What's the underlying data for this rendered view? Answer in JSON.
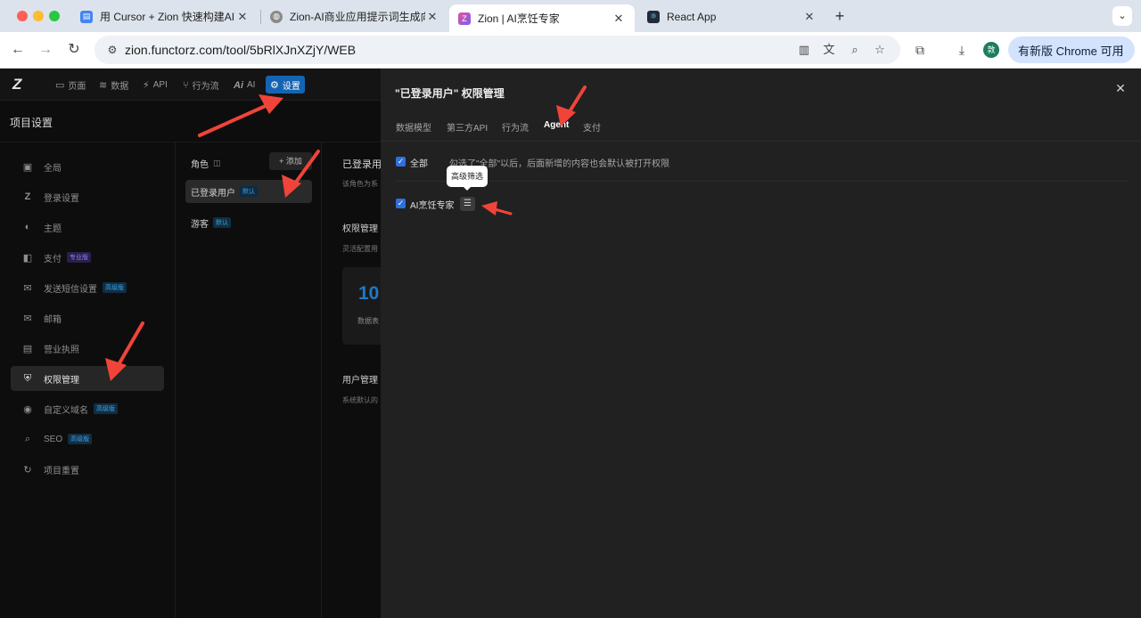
{
  "browser": {
    "tabs": [
      {
        "title": "用 Cursor + Zion 快速构建AI商",
        "favicon_color": "#4285f4"
      },
      {
        "title": "Zion-AI商业应用提示词生成向导",
        "favicon_color": "#8a8a8a"
      },
      {
        "title": "Zion | AI烹饪专家",
        "favicon_color": "#a35bf5"
      },
      {
        "title": "React App",
        "favicon_color": "#1f2a3a"
      }
    ],
    "url": "zion.functorz.com/tool/5bRlXJnXZjY/WEB",
    "update_label": "有新版 Chrome 可用",
    "profile_initial": "敦"
  },
  "app": {
    "nav": [
      {
        "label": "页面",
        "icon": "▭"
      },
      {
        "label": "数据",
        "icon": "≋"
      },
      {
        "label": "API",
        "icon": "⚡"
      },
      {
        "label": "行为流",
        "icon": "⑂"
      },
      {
        "label": "AI",
        "icon": "Ai"
      },
      {
        "label": "设置",
        "icon": "⚙"
      }
    ],
    "project_title": "项目设置",
    "sidebar": [
      {
        "label": "全局",
        "icon": "▣",
        "badge": ""
      },
      {
        "label": "登录设置",
        "icon": "Z",
        "badge": ""
      },
      {
        "label": "主题",
        "icon": "◐",
        "badge": ""
      },
      {
        "label": "支付",
        "icon": "◧",
        "badge": "专业版"
      },
      {
        "label": "发送短信设置",
        "icon": "✉",
        "badge": "高级版"
      },
      {
        "label": "邮箱",
        "icon": "✉",
        "badge": ""
      },
      {
        "label": "营业执照",
        "icon": "▤",
        "badge": ""
      },
      {
        "label": "权限管理",
        "icon": "⛨",
        "badge": ""
      },
      {
        "label": "自定义域名",
        "icon": "◉",
        "badge": "高级版"
      },
      {
        "label": "SEO",
        "icon": "⌕",
        "badge": "高级版"
      },
      {
        "label": "项目重置",
        "icon": "↻",
        "badge": ""
      }
    ],
    "roles": {
      "header": "角色",
      "add_label": "+ 添加",
      "items": [
        {
          "label": "已登录用户",
          "badge": "默认"
        },
        {
          "label": "游客",
          "badge": "默认"
        }
      ]
    },
    "detail": {
      "title": "已登录用",
      "desc": "该角色为系",
      "perm_title": "权限管理",
      "perm_desc": "灵活配置用",
      "stat_value": "10",
      "stat_label": "数据表",
      "user_title": "用户管理",
      "user_desc": "系统默认的"
    }
  },
  "drawer": {
    "title": "\"已登录用户\" 权限管理",
    "tabs": [
      "数据模型",
      "第三方API",
      "行为流",
      "Agent",
      "支付"
    ],
    "selected_tab": "Agent",
    "all_label": "全部",
    "all_hint": "勾选了\"全部\"以后，后面新增的内容也会默认被打开权限",
    "item_label": "AI烹饪专家",
    "tooltip": "高级筛选"
  },
  "colors": {
    "accent": "#1464b4",
    "checkbox": "#2f6fdb",
    "annotation_arrow": "#f0443a"
  }
}
